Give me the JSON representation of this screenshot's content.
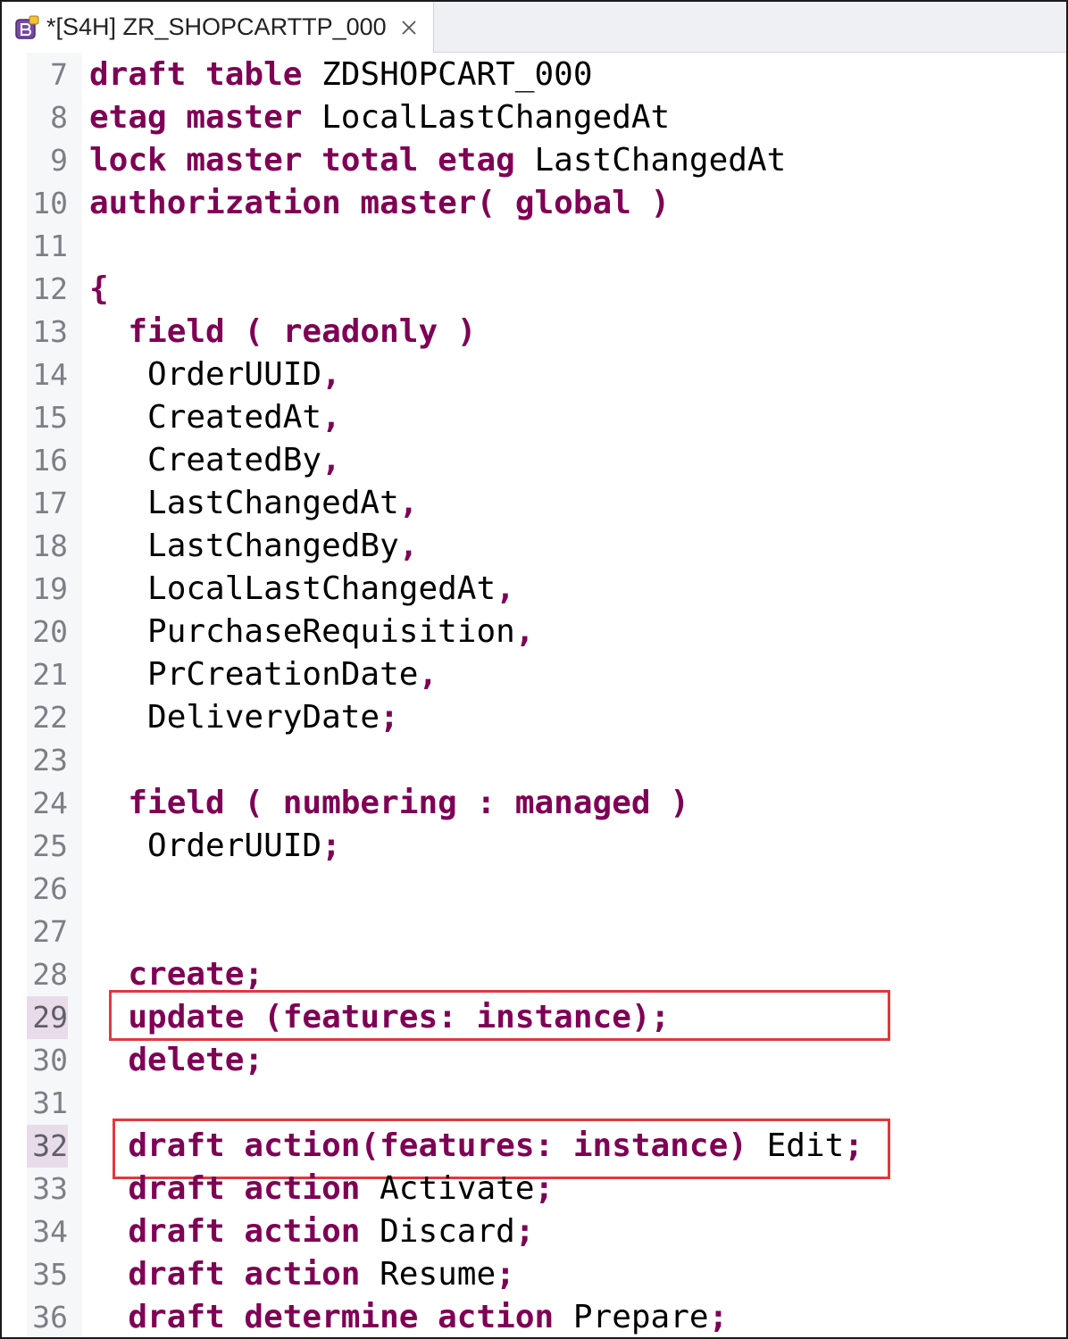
{
  "tab": {
    "title": "*[S4H] ZR_SHOPCARTTP_000",
    "icon": "behavior-definition-icon",
    "close_icon": "close-icon"
  },
  "colors": {
    "keyword": "#7f0055",
    "identifier": "#000000",
    "line_number": "#7b7f86",
    "line_highlight": "#e9dcea",
    "highlight_box": "#e0393b"
  },
  "highlighted_lines": [
    29,
    32
  ],
  "lines": [
    {
      "n": "7",
      "tokens": [
        {
          "t": "draft table",
          "k": "kw"
        },
        {
          "t": " ZDSHOPCART_000",
          "k": "id"
        }
      ]
    },
    {
      "n": "8",
      "tokens": [
        {
          "t": "etag master",
          "k": "kw"
        },
        {
          "t": " LocalLastChangedAt",
          "k": "id"
        }
      ]
    },
    {
      "n": "9",
      "tokens": [
        {
          "t": "lock master total etag",
          "k": "kw"
        },
        {
          "t": " LastChangedAt",
          "k": "id"
        }
      ]
    },
    {
      "n": "10",
      "tokens": [
        {
          "t": "authorization master( global )",
          "k": "kw"
        }
      ]
    },
    {
      "n": "11",
      "tokens": []
    },
    {
      "n": "12",
      "tokens": [
        {
          "t": "{",
          "k": "kw"
        }
      ]
    },
    {
      "n": "13",
      "tokens": [
        {
          "t": "  field ( readonly )",
          "k": "kw"
        }
      ]
    },
    {
      "n": "14",
      "tokens": [
        {
          "t": "   OrderUUID",
          "k": "id"
        },
        {
          "t": ",",
          "k": "kw"
        }
      ]
    },
    {
      "n": "15",
      "tokens": [
        {
          "t": "   CreatedAt",
          "k": "id"
        },
        {
          "t": ",",
          "k": "kw"
        }
      ]
    },
    {
      "n": "16",
      "tokens": [
        {
          "t": "   CreatedBy",
          "k": "id"
        },
        {
          "t": ",",
          "k": "kw"
        }
      ]
    },
    {
      "n": "17",
      "tokens": [
        {
          "t": "   LastChangedAt",
          "k": "id"
        },
        {
          "t": ",",
          "k": "kw"
        }
      ]
    },
    {
      "n": "18",
      "tokens": [
        {
          "t": "   LastChangedBy",
          "k": "id"
        },
        {
          "t": ",",
          "k": "kw"
        }
      ]
    },
    {
      "n": "19",
      "tokens": [
        {
          "t": "   LocalLastChangedAt",
          "k": "id"
        },
        {
          "t": ",",
          "k": "kw"
        }
      ]
    },
    {
      "n": "20",
      "tokens": [
        {
          "t": "   PurchaseRequisition",
          "k": "id"
        },
        {
          "t": ",",
          "k": "kw"
        }
      ]
    },
    {
      "n": "21",
      "tokens": [
        {
          "t": "   PrCreationDate",
          "k": "id"
        },
        {
          "t": ",",
          "k": "kw"
        }
      ]
    },
    {
      "n": "22",
      "tokens": [
        {
          "t": "   DeliveryDate",
          "k": "id"
        },
        {
          "t": ";",
          "k": "kw"
        }
      ]
    },
    {
      "n": "23",
      "tokens": []
    },
    {
      "n": "24",
      "tokens": [
        {
          "t": "  field ( numbering : managed )",
          "k": "kw"
        }
      ]
    },
    {
      "n": "25",
      "tokens": [
        {
          "t": "   OrderUUID",
          "k": "id"
        },
        {
          "t": ";",
          "k": "kw"
        }
      ]
    },
    {
      "n": "26",
      "tokens": []
    },
    {
      "n": "27",
      "tokens": []
    },
    {
      "n": "28",
      "tokens": [
        {
          "t": "  create;",
          "k": "kw"
        }
      ]
    },
    {
      "n": "29",
      "tokens": [
        {
          "t": "  update (features: instance);",
          "k": "kw"
        }
      ]
    },
    {
      "n": "30",
      "tokens": [
        {
          "t": "  delete;",
          "k": "kw"
        }
      ]
    },
    {
      "n": "31",
      "tokens": []
    },
    {
      "n": "32",
      "tokens": [
        {
          "t": "  draft action(features: instance)",
          "k": "kw"
        },
        {
          "t": " Edit",
          "k": "id"
        },
        {
          "t": ";",
          "k": "kw"
        }
      ]
    },
    {
      "n": "33",
      "tokens": [
        {
          "t": "  draft action",
          "k": "kw"
        },
        {
          "t": " Activate",
          "k": "id"
        },
        {
          "t": ";",
          "k": "kw"
        }
      ]
    },
    {
      "n": "34",
      "tokens": [
        {
          "t": "  draft action",
          "k": "kw"
        },
        {
          "t": " Discard",
          "k": "id"
        },
        {
          "t": ";",
          "k": "kw"
        }
      ]
    },
    {
      "n": "35",
      "tokens": [
        {
          "t": "  draft action",
          "k": "kw"
        },
        {
          "t": " Resume",
          "k": "id"
        },
        {
          "t": ";",
          "k": "kw"
        }
      ]
    },
    {
      "n": "36",
      "tokens": [
        {
          "t": "  draft determine action",
          "k": "kw"
        },
        {
          "t": " Prepare",
          "k": "id"
        },
        {
          "t": ";",
          "k": "kw"
        }
      ]
    }
  ]
}
